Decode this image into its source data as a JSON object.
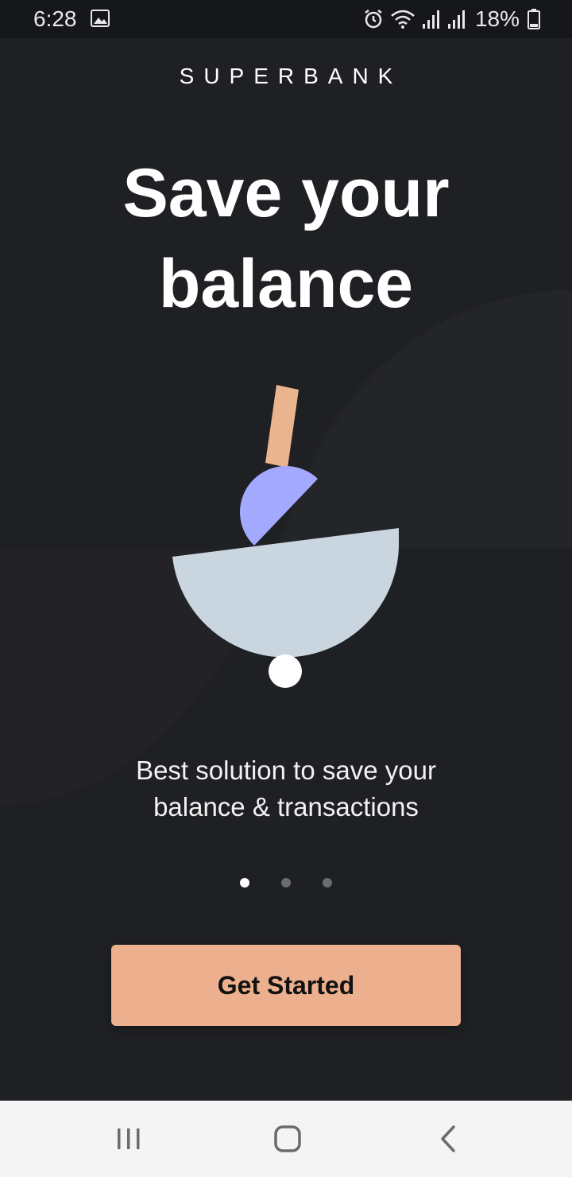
{
  "status_bar": {
    "time": "6:28",
    "battery_percent": "18%",
    "icons": [
      "gallery-icon",
      "alarm-icon",
      "wifi-icon",
      "signal-icon",
      "signal-icon",
      "battery-icon"
    ]
  },
  "brand": {
    "name": "SUPERBANK"
  },
  "headline": {
    "line1": "Save your",
    "line2": "balance"
  },
  "subtitle": {
    "line1": "Best solution to save your",
    "line2": "balance & transactions"
  },
  "pager": {
    "total": 3,
    "active_index": 0
  },
  "cta": {
    "label": "Get Started"
  },
  "nav": {
    "buttons": [
      "recent-apps-icon",
      "home-icon",
      "back-icon"
    ]
  },
  "colors": {
    "background": "#1f2024",
    "accent": "#edb08e",
    "half_circle_small": "#a3a9ff",
    "bowl": "#c9d6e0",
    "stick": "#e9b48e"
  }
}
